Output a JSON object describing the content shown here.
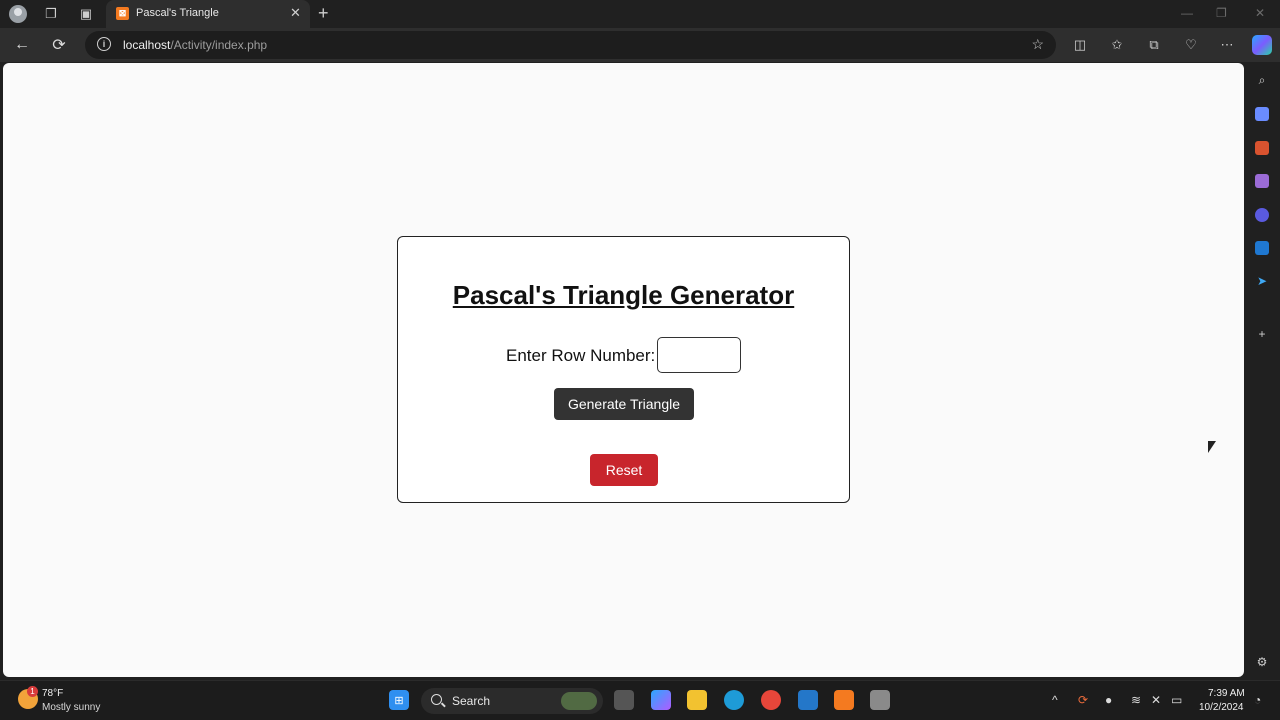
{
  "tab": {
    "title": "Pascal's Triangle",
    "close": "✕",
    "new": "+"
  },
  "address": {
    "info": "i",
    "host": "localhost",
    "path": "/Activity/index.php"
  },
  "page": {
    "title": "Pascal's Triangle Generator",
    "row_label": "Enter Row Number:",
    "row_value": "",
    "generate_label": "Generate Triangle",
    "reset_label": "Reset"
  },
  "taskbar": {
    "temperature": "78°F",
    "weather": "Mostly sunny",
    "weather_badge": "1",
    "search_label": "Search",
    "time": "7:39 AM",
    "date": "10/2/2024"
  },
  "colors": {
    "reset": "#c8252c",
    "generate": "#333333",
    "accent": "#2aa8ff"
  }
}
